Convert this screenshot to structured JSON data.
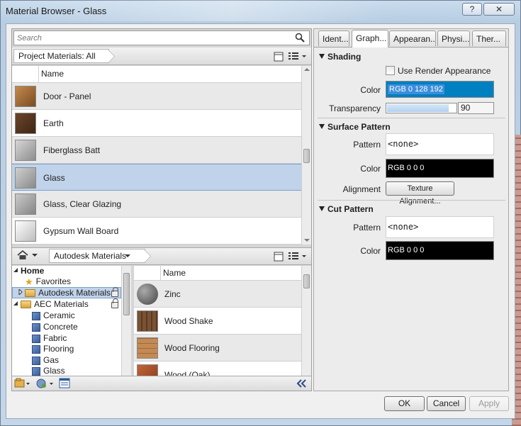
{
  "window": {
    "title": "Material Browser - Glass",
    "help_label": "?",
    "close_label": "✕"
  },
  "search": {
    "placeholder": "Search"
  },
  "project": {
    "filter_label": "Project Materials: All",
    "column_name": "Name",
    "materials": [
      {
        "name": "Door - Panel",
        "swatch": "#9a6a3a"
      },
      {
        "name": "Earth",
        "swatch": "#5a3a22"
      },
      {
        "name": "Fiberglass Batt",
        "swatch": "#b0b0b0"
      },
      {
        "name": "Glass",
        "swatch": "#a9a9a9",
        "selected": true
      },
      {
        "name": "Glass, Clear Glazing",
        "swatch": "#a3a3a3"
      },
      {
        "name": "Gypsum Wall Board",
        "swatch": "#e8e8e8"
      }
    ]
  },
  "library": {
    "breadcrumb": "Autodesk Materials",
    "tree": {
      "home": "Home",
      "favorites": "Favorites",
      "autodesk_materials": "Autodesk Materials",
      "aec_materials": "AEC Materials",
      "categories": [
        "Ceramic",
        "Concrete",
        "Fabric",
        "Flooring",
        "Gas",
        "Glass"
      ]
    },
    "column_name": "Name",
    "materials": [
      {
        "name": "Zinc",
        "swatch": "#6e6e6e"
      },
      {
        "name": "Wood Shake",
        "swatch": "#6e4a2c"
      },
      {
        "name": "Wood Flooring",
        "swatch": "#b07b48"
      },
      {
        "name": "Wood (Oak)",
        "swatch": "#a0522d"
      }
    ]
  },
  "tabs": [
    "Ident...",
    "Graph...",
    "Appearan...",
    "Physi...",
    "Ther..."
  ],
  "active_tab": "Graph...",
  "graphics": {
    "shading": {
      "header": "Shading",
      "use_render_appearance_label": "Use Render Appearance",
      "use_render_appearance": false,
      "color_label": "Color",
      "color_value": "RGB 0 128 192",
      "color_hex": "#0080c0",
      "transparency_label": "Transparency",
      "transparency_value": "90",
      "transparency_fraction": 0.9
    },
    "surface_pattern": {
      "header": "Surface Pattern",
      "pattern_label": "Pattern",
      "pattern_value": "<none>",
      "color_label": "Color",
      "color_value": "RGB 0 0 0",
      "alignment_label": "Alignment",
      "alignment_button": "Texture Alignment..."
    },
    "cut_pattern": {
      "header": "Cut Pattern",
      "pattern_label": "Pattern",
      "pattern_value": "<none>",
      "color_label": "Color",
      "color_value": "RGB 0 0 0"
    }
  },
  "buttons": {
    "ok": "OK",
    "cancel": "Cancel",
    "apply": "Apply"
  }
}
